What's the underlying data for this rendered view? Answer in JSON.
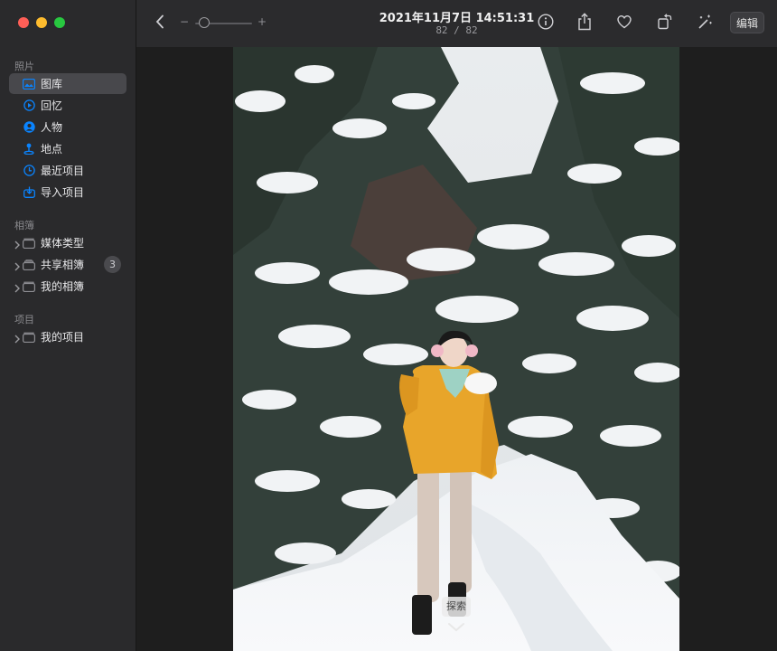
{
  "sidebar": {
    "section_photos": "照片",
    "section_albums": "相簿",
    "section_projects": "项目",
    "items": [
      {
        "label": "图库",
        "icon": "library-icon"
      },
      {
        "label": "回忆",
        "icon": "memories-icon"
      },
      {
        "label": "人物",
        "icon": "people-icon"
      },
      {
        "label": "地点",
        "icon": "places-icon"
      },
      {
        "label": "最近项目",
        "icon": "recents-icon"
      },
      {
        "label": "导入项目",
        "icon": "imports-icon"
      }
    ],
    "albums": [
      {
        "label": "媒体类型",
        "icon": "folder-icon"
      },
      {
        "label": "共享相簿",
        "icon": "shared-albums-icon",
        "badge": "3"
      },
      {
        "label": "我的相簿",
        "icon": "folder-icon"
      }
    ],
    "projects": [
      {
        "label": "我的项目",
        "icon": "folder-icon"
      }
    ],
    "accent_color": "#0a84ff"
  },
  "toolbar": {
    "title": "2021年11月7日 14:51:31",
    "counter": "82 / 82",
    "zoom_minus": "−",
    "zoom_plus": "+",
    "zoom_level": 0.1,
    "edit_label": "编辑"
  },
  "viewer": {
    "explore_label": "探索"
  }
}
